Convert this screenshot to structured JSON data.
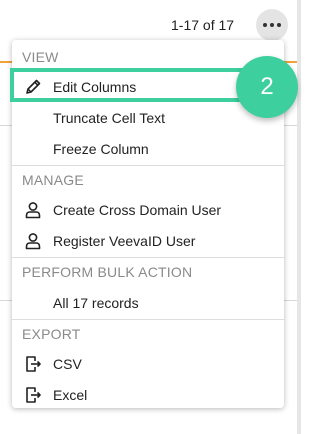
{
  "pagination": {
    "text": "1-17 of 17"
  },
  "more_button": {
    "icon": "more-horizontal-icon"
  },
  "menu": {
    "sections": [
      {
        "heading": "VIEW",
        "items": [
          {
            "label": "Edit Columns",
            "icon": "pencil-icon"
          },
          {
            "label": "Truncate Cell Text",
            "icon": ""
          },
          {
            "label": "Freeze Column",
            "icon": ""
          }
        ]
      },
      {
        "heading": "MANAGE",
        "items": [
          {
            "label": "Create Cross Domain User",
            "icon": "user-icon"
          },
          {
            "label": "Register VeevaID User",
            "icon": "user-icon"
          }
        ]
      },
      {
        "heading": "PERFORM BULK ACTION",
        "items": [
          {
            "label": "All 17 records",
            "icon": ""
          }
        ]
      },
      {
        "heading": "EXPORT",
        "items": [
          {
            "label": "CSV",
            "icon": "file-export-icon"
          },
          {
            "label": "Excel",
            "icon": "file-export-icon"
          }
        ]
      }
    ]
  },
  "step_badge": {
    "number": "2",
    "color": "#3ecf9e"
  }
}
